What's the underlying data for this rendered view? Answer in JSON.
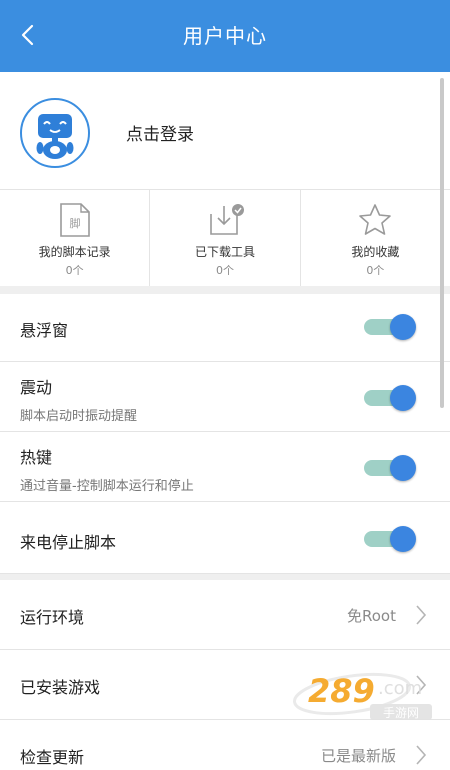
{
  "header": {
    "title": "用户中心"
  },
  "profile": {
    "login_text": "点击登录"
  },
  "stats": [
    {
      "label": "我的脚本记录",
      "count": "0个",
      "icon": "script-doc-icon",
      "icon_glyph": "脚"
    },
    {
      "label": "已下载工具",
      "count": "0个",
      "icon": "download-tray-icon"
    },
    {
      "label": "我的收藏",
      "count": "0个",
      "icon": "star-icon"
    }
  ],
  "settings": [
    {
      "label": "悬浮窗",
      "enabled": true
    },
    {
      "label": "震动",
      "sub": "脚本启动时振动提醒",
      "enabled": true
    },
    {
      "label": "热键",
      "sub": "通过音量-控制脚本运行和停止",
      "enabled": true
    },
    {
      "label": "来电停止脚本",
      "enabled": true
    }
  ],
  "nav": [
    {
      "label": "运行环境",
      "value": "免Root"
    },
    {
      "label": "已安装游戏",
      "value": ""
    },
    {
      "label": "检查更新",
      "value": "已是最新版"
    }
  ],
  "watermark": {
    "text": "289.com 手游网"
  },
  "colors": {
    "accent": "#3b8ee0",
    "toggle_track": "#9fd0c6",
    "toggle_knob": "#3b85e0"
  }
}
